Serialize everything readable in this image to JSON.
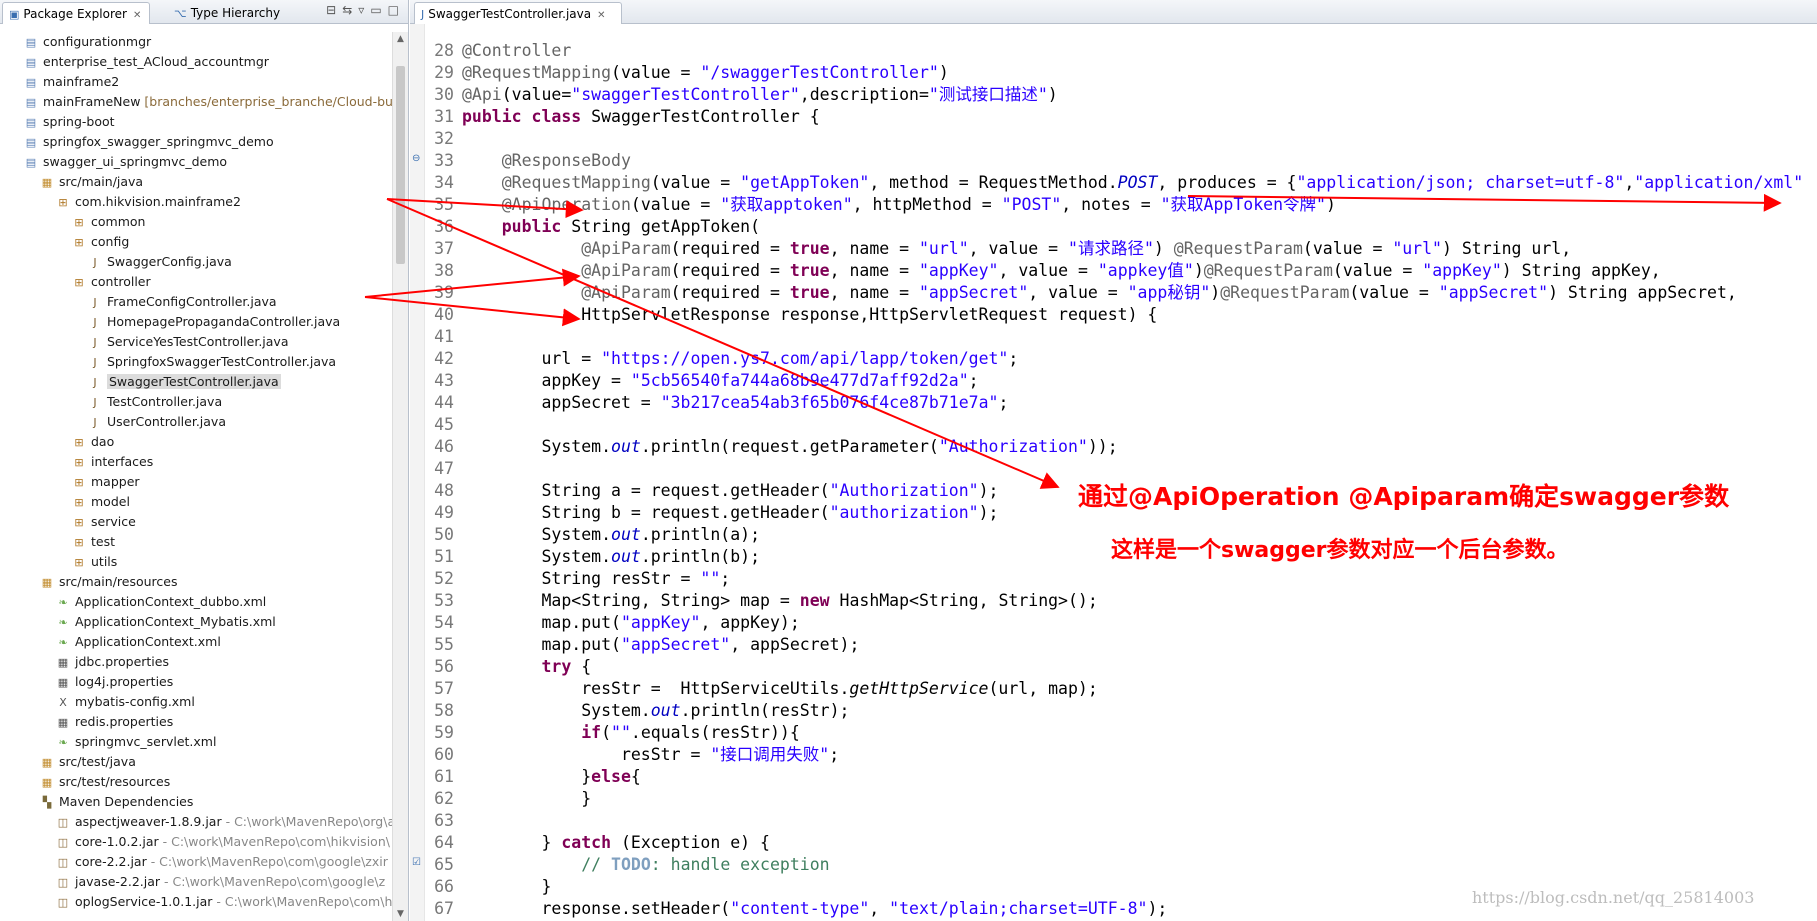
{
  "left_panel": {
    "tabs": [
      {
        "label": "Package Explorer",
        "icon": "package-icon"
      },
      {
        "label": "Type Hierarchy",
        "icon": "hierarchy-icon"
      }
    ],
    "tree": [
      {
        "label": "configurationmgr",
        "icon": "project-icon",
        "indent": 1
      },
      {
        "label": "enterprise_test_ACloud_accountmgr",
        "icon": "project-icon",
        "indent": 1
      },
      {
        "label": "mainframe2",
        "icon": "project-icon",
        "indent": 1
      },
      {
        "label": "mainFrameNew",
        "icon": "project-icon",
        "indent": 1,
        "decoration": " [branches/enterprise_branche/Cloud-bu/S"
      },
      {
        "label": "spring-boot",
        "icon": "project-icon",
        "indent": 1
      },
      {
        "label": "springfox_swagger_springmvc_demo",
        "icon": "project-icon",
        "indent": 1
      },
      {
        "label": "swagger_ui_springmvc_demo",
        "icon": "project-icon",
        "indent": 1
      },
      {
        "label": "src/main/java",
        "icon": "source-folder-icon",
        "indent": 2
      },
      {
        "label": "com.hikvision.mainframe2",
        "icon": "package-icon",
        "indent": 3
      },
      {
        "label": "common",
        "icon": "package-icon",
        "indent": 4
      },
      {
        "label": "config",
        "icon": "package-icon",
        "indent": 4
      },
      {
        "label": "SwaggerConfig.java",
        "icon": "java-file-icon",
        "indent": 5
      },
      {
        "label": "controller",
        "icon": "package-icon",
        "indent": 4
      },
      {
        "label": "FrameConfigController.java",
        "icon": "java-file-icon",
        "indent": 5
      },
      {
        "label": "HomepagePropagandaController.java",
        "icon": "java-file-icon",
        "indent": 5
      },
      {
        "label": "ServiceYesTestController.java",
        "icon": "java-file-icon",
        "indent": 5
      },
      {
        "label": "SpringfoxSwaggerTestController.java",
        "icon": "java-file-icon",
        "indent": 5
      },
      {
        "label": "SwaggerTestController.java",
        "icon": "java-file-icon",
        "indent": 5,
        "selected": true
      },
      {
        "label": "TestController.java",
        "icon": "java-file-icon",
        "indent": 5
      },
      {
        "label": "UserController.java",
        "icon": "java-file-icon",
        "indent": 5
      },
      {
        "label": "dao",
        "icon": "package-icon",
        "indent": 4
      },
      {
        "label": "interfaces",
        "icon": "package-icon",
        "indent": 4
      },
      {
        "label": "mapper",
        "icon": "package-icon",
        "indent": 4
      },
      {
        "label": "model",
        "icon": "package-icon",
        "indent": 4
      },
      {
        "label": "service",
        "icon": "package-icon",
        "indent": 4
      },
      {
        "label": "test",
        "icon": "package-icon",
        "indent": 4
      },
      {
        "label": "utils",
        "icon": "package-icon",
        "indent": 4
      },
      {
        "label": "src/main/resources",
        "icon": "source-folder-icon",
        "indent": 2
      },
      {
        "label": "ApplicationContext_dubbo.xml",
        "icon": "spring-xml-icon",
        "indent": 3
      },
      {
        "label": "ApplicationContext_Mybatis.xml",
        "icon": "spring-xml-icon",
        "indent": 3
      },
      {
        "label": "ApplicationContext.xml",
        "icon": "spring-xml-icon",
        "indent": 3
      },
      {
        "label": "jdbc.properties",
        "icon": "properties-file-icon",
        "indent": 3
      },
      {
        "label": "log4j.properties",
        "icon": "properties-file-icon",
        "indent": 3
      },
      {
        "label": "mybatis-config.xml",
        "icon": "xml-file-icon",
        "indent": 3
      },
      {
        "label": "redis.properties",
        "icon": "properties-file-icon",
        "indent": 3
      },
      {
        "label": "springmvc_servlet.xml",
        "icon": "spring-xml-icon",
        "indent": 3
      },
      {
        "label": "src/test/java",
        "icon": "source-folder-icon",
        "indent": 2
      },
      {
        "label": "src/test/resources",
        "icon": "source-folder-icon",
        "indent": 2
      },
      {
        "label": "Maven Dependencies",
        "icon": "library-icon",
        "indent": 2
      },
      {
        "label": "aspectjweaver-1.8.9.jar",
        "icon": "jar-icon",
        "indent": 3,
        "path": " - C:\\work\\MavenRepo\\org\\a"
      },
      {
        "label": "core-1.0.2.jar",
        "icon": "jar-icon",
        "indent": 3,
        "path": " - C:\\work\\MavenRepo\\com\\hikvision\\"
      },
      {
        "label": "core-2.2.jar",
        "icon": "jar-icon",
        "indent": 3,
        "path": " - C:\\work\\MavenRepo\\com\\google\\zxir"
      },
      {
        "label": "javase-2.2.jar",
        "icon": "jar-icon",
        "indent": 3,
        "path": " - C:\\work\\MavenRepo\\com\\google\\z"
      },
      {
        "label": "oplogService-1.0.1.jar",
        "icon": "jar-icon",
        "indent": 3,
        "path": " - C:\\work\\MavenRepo\\com\\h"
      }
    ]
  },
  "editor": {
    "tab_label": "SwaggerTestController.java",
    "lines": [
      {
        "n": "28",
        "t": [
          [
            "@Controller",
            "an"
          ]
        ]
      },
      {
        "n": "29",
        "t": [
          [
            "@RequestMapping",
            "an"
          ],
          [
            "(value = ",
            ""
          ],
          [
            "\"/swaggerTestController\"",
            "st"
          ],
          [
            ")",
            ""
          ]
        ]
      },
      {
        "n": "30",
        "t": [
          [
            "@Api",
            "an"
          ],
          [
            "(value=",
            ""
          ],
          [
            "\"swaggerTestController\"",
            "st"
          ],
          [
            ",description=",
            ""
          ],
          [
            "\"测试接口描述\"",
            "st"
          ],
          [
            ")",
            ""
          ]
        ]
      },
      {
        "n": "31",
        "t": [
          [
            "public",
            "kw"
          ],
          [
            " ",
            ""
          ],
          [
            "class",
            "kw"
          ],
          [
            " SwaggerTestController {",
            ""
          ]
        ]
      },
      {
        "n": "32",
        "t": []
      },
      {
        "n": "33",
        "marker": "⊖",
        "t": [
          [
            "    ",
            ""
          ],
          [
            "@ResponseBody",
            "an"
          ]
        ]
      },
      {
        "n": "34",
        "t": [
          [
            "    ",
            ""
          ],
          [
            "@RequestMapping",
            "an"
          ],
          [
            "(value = ",
            ""
          ],
          [
            "\"getAppToken\"",
            "st"
          ],
          [
            ", method = RequestMethod.",
            ""
          ],
          [
            "POST",
            "fd"
          ],
          [
            ", produces = {",
            ""
          ],
          [
            "\"application/json; charset=utf-8\"",
            "st"
          ],
          [
            ",",
            ""
          ],
          [
            "\"application/xml\"",
            "st"
          ]
        ]
      },
      {
        "n": "35",
        "t": [
          [
            "    ",
            ""
          ],
          [
            "@ApiOperation",
            "an"
          ],
          [
            "(value = ",
            ""
          ],
          [
            "\"获取apptoken\"",
            "st"
          ],
          [
            ", httpMethod = ",
            ""
          ],
          [
            "\"POST\"",
            "st"
          ],
          [
            ", notes = ",
            ""
          ],
          [
            "\"获取AppToken令牌\"",
            "st"
          ],
          [
            ")",
            ""
          ]
        ]
      },
      {
        "n": "36",
        "t": [
          [
            "    ",
            ""
          ],
          [
            "public",
            "kw"
          ],
          [
            " String getAppToken(",
            ""
          ]
        ]
      },
      {
        "n": "37",
        "t": [
          [
            "            ",
            ""
          ],
          [
            "@ApiParam",
            "an"
          ],
          [
            "(required = ",
            ""
          ],
          [
            "true",
            "kw"
          ],
          [
            ", name = ",
            ""
          ],
          [
            "\"url\"",
            "st"
          ],
          [
            ", value = ",
            ""
          ],
          [
            "\"请求路径\"",
            "st"
          ],
          [
            ") ",
            ""
          ],
          [
            "@RequestParam",
            "an"
          ],
          [
            "(value = ",
            ""
          ],
          [
            "\"url\"",
            "st"
          ],
          [
            ") String url,",
            ""
          ]
        ]
      },
      {
        "n": "38",
        "t": [
          [
            "            ",
            ""
          ],
          [
            "@ApiParam",
            "an"
          ],
          [
            "(required = ",
            ""
          ],
          [
            "true",
            "kw"
          ],
          [
            ", name = ",
            ""
          ],
          [
            "\"appKey\"",
            "st"
          ],
          [
            ", value = ",
            ""
          ],
          [
            "\"appkey值\"",
            "st"
          ],
          [
            ")",
            ""
          ],
          [
            "@RequestParam",
            "an"
          ],
          [
            "(value = ",
            ""
          ],
          [
            "\"appKey\"",
            "st"
          ],
          [
            ") String appKey,",
            ""
          ]
        ]
      },
      {
        "n": "39",
        "t": [
          [
            "            ",
            ""
          ],
          [
            "@ApiParam",
            "an"
          ],
          [
            "(required = ",
            ""
          ],
          [
            "true",
            "kw"
          ],
          [
            ", name = ",
            ""
          ],
          [
            "\"appSecret\"",
            "st"
          ],
          [
            ", value = ",
            ""
          ],
          [
            "\"app秘钥\"",
            "st"
          ],
          [
            ")",
            ""
          ],
          [
            "@RequestParam",
            "an"
          ],
          [
            "(value = ",
            ""
          ],
          [
            "\"appSecret\"",
            "st"
          ],
          [
            ") String appSecret,",
            ""
          ]
        ]
      },
      {
        "n": "40",
        "t": [
          [
            "            HttpServletResponse response,HttpServletRequest request) {",
            ""
          ]
        ]
      },
      {
        "n": "41",
        "t": []
      },
      {
        "n": "42",
        "t": [
          [
            "        url = ",
            ""
          ],
          [
            "\"https://open.ys7.com/api/lapp/token/get\"",
            "st"
          ],
          [
            ";",
            ""
          ]
        ]
      },
      {
        "n": "43",
        "t": [
          [
            "        appKey = ",
            ""
          ],
          [
            "\"5cb56540fa744a68b9e477d7aff92d2a\"",
            "st"
          ],
          [
            ";",
            ""
          ]
        ]
      },
      {
        "n": "44",
        "t": [
          [
            "        appSecret = ",
            ""
          ],
          [
            "\"3b217cea54ab3f65b076f4ce87b71e7a\"",
            "st"
          ],
          [
            ";",
            ""
          ]
        ]
      },
      {
        "n": "45",
        "t": []
      },
      {
        "n": "46",
        "t": [
          [
            "        System.",
            ""
          ],
          [
            "out",
            "fd"
          ],
          [
            ".println(request.getParameter(",
            ""
          ],
          [
            "\"Authorization\"",
            "st"
          ],
          [
            "));",
            ""
          ]
        ]
      },
      {
        "n": "47",
        "t": []
      },
      {
        "n": "48",
        "t": [
          [
            "        String a = request.getHeader(",
            ""
          ],
          [
            "\"Authorization\"",
            "st"
          ],
          [
            ");",
            ""
          ]
        ]
      },
      {
        "n": "49",
        "t": [
          [
            "        String b = request.getHeader(",
            ""
          ],
          [
            "\"authorization\"",
            "st"
          ],
          [
            ");",
            ""
          ]
        ]
      },
      {
        "n": "50",
        "t": [
          [
            "        System.",
            ""
          ],
          [
            "out",
            "fd"
          ],
          [
            ".println(a);",
            ""
          ]
        ]
      },
      {
        "n": "51",
        "t": [
          [
            "        System.",
            ""
          ],
          [
            "out",
            "fd"
          ],
          [
            ".println(b);",
            ""
          ]
        ]
      },
      {
        "n": "52",
        "t": [
          [
            "        String resStr = ",
            ""
          ],
          [
            "\"\"",
            "st"
          ],
          [
            ";",
            ""
          ]
        ]
      },
      {
        "n": "53",
        "t": [
          [
            "        Map<String, String> map = ",
            ""
          ],
          [
            "new",
            "kw"
          ],
          [
            " HashMap<String, String>();",
            ""
          ]
        ]
      },
      {
        "n": "54",
        "t": [
          [
            "        map.put(",
            ""
          ],
          [
            "\"appKey\"",
            "st"
          ],
          [
            ", appKey);",
            ""
          ]
        ]
      },
      {
        "n": "55",
        "t": [
          [
            "        map.put(",
            ""
          ],
          [
            "\"appSecret\"",
            "st"
          ],
          [
            ", appSecret);",
            ""
          ]
        ]
      },
      {
        "n": "56",
        "t": [
          [
            "        ",
            ""
          ],
          [
            "try",
            "kw"
          ],
          [
            " {",
            ""
          ]
        ]
      },
      {
        "n": "57",
        "t": [
          [
            "            resStr =  HttpServiceUtils.",
            ""
          ],
          [
            "getHttpService",
            "it"
          ],
          [
            "(url, map);",
            ""
          ]
        ]
      },
      {
        "n": "58",
        "t": [
          [
            "            System.",
            ""
          ],
          [
            "out",
            "fd"
          ],
          [
            ".println(resStr);",
            ""
          ]
        ]
      },
      {
        "n": "59",
        "t": [
          [
            "            ",
            ""
          ],
          [
            "if",
            "kw"
          ],
          [
            "(",
            ""
          ],
          [
            "\"\"",
            "st"
          ],
          [
            ".equals(resStr)){",
            ""
          ]
        ]
      },
      {
        "n": "60",
        "t": [
          [
            "                resStr = ",
            ""
          ],
          [
            "\"接口调用失败\"",
            "st"
          ],
          [
            ";",
            ""
          ]
        ]
      },
      {
        "n": "61",
        "t": [
          [
            "            }",
            ""
          ],
          [
            "else",
            "kw"
          ],
          [
            "{",
            ""
          ]
        ]
      },
      {
        "n": "62",
        "t": [
          [
            "            }",
            ""
          ]
        ]
      },
      {
        "n": "63",
        "t": []
      },
      {
        "n": "64",
        "t": [
          [
            "        } ",
            ""
          ],
          [
            "catch",
            "kw"
          ],
          [
            " (Exception e) {",
            ""
          ]
        ]
      },
      {
        "n": "65",
        "marker": "☑",
        "t": [
          [
            "            ",
            ""
          ],
          [
            "// ",
            "cm"
          ],
          [
            "TODO",
            "td"
          ],
          [
            ": handle exception",
            "cm"
          ]
        ]
      },
      {
        "n": "66",
        "t": [
          [
            "        }",
            ""
          ]
        ]
      },
      {
        "n": "67",
        "t": [
          [
            "        response.setHeader(",
            ""
          ],
          [
            "\"content-type\"",
            "st"
          ],
          [
            ", ",
            ""
          ],
          [
            "\"text/plain;charset=UTF-8\"",
            "st"
          ],
          [
            ");",
            ""
          ]
        ]
      }
    ]
  },
  "annotations": {
    "note1": "通过@ApiOperation @Apiparam确定swagger参数",
    "note2": "这样是一个swagger参数对应一个后台参数。",
    "arrow_color": "#ff0000"
  },
  "watermark": "https://blog.csdn.net/qq_25814003"
}
